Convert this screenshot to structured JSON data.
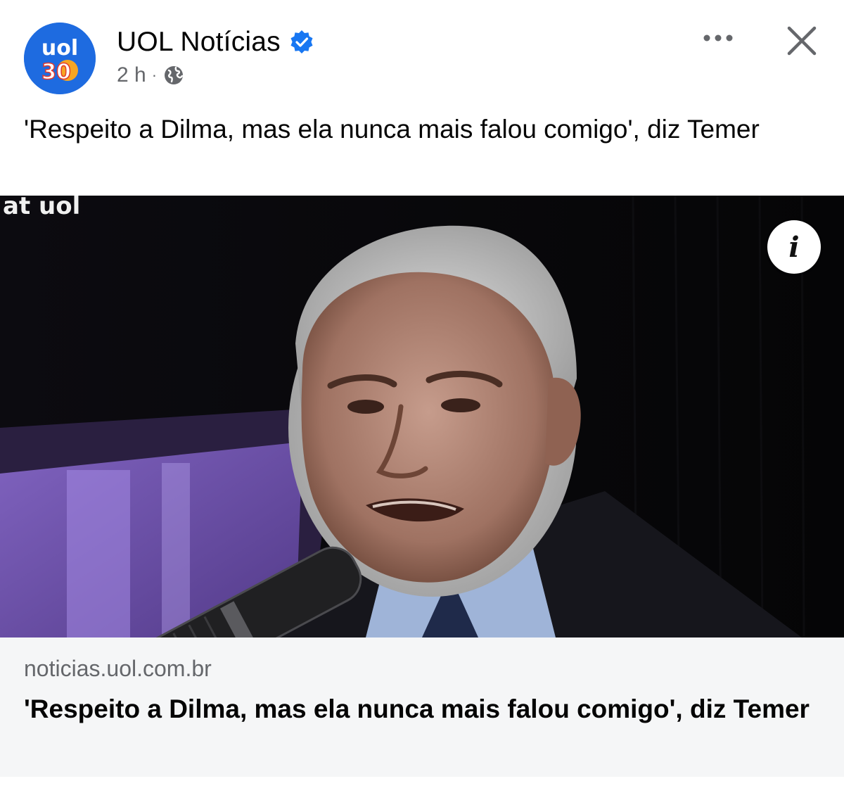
{
  "post": {
    "page_name": "UOL Notícias",
    "avatar": {
      "top_text": "uol",
      "bottom_text": "30",
      "color": "#1e6be0"
    },
    "verified_icon": "verified-badge-icon",
    "time": "2 h",
    "separator": "·",
    "audience_icon": "globe-icon",
    "caption": "'Respeito a Dilma, mas ela nunca mais falou comigo', diz Temer"
  },
  "actions": {
    "more_label": "•••",
    "more_icon": "more-options-icon",
    "close_icon": "close-icon"
  },
  "media": {
    "watermark": "at uol",
    "info_label": "i",
    "info_icon": "info-icon"
  },
  "link_preview": {
    "domain": "noticias.uol.com.br",
    "title": "'Respeito a Dilma, mas ela nunca mais falou comigo', diz Temer"
  },
  "colors": {
    "accent": "#1877f2",
    "secondary_text": "#65676b",
    "card_background": "#f5f6f7"
  }
}
